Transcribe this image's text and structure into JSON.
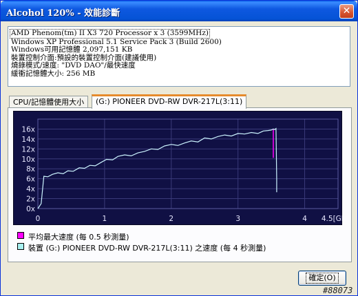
{
  "window": {
    "title": "Alcohol 120% - 效能診斷",
    "close_symbol": "✕"
  },
  "info": {
    "lines": [
      "AMD Phenom(tm) II X3 720 Processor x 3 (3599MHz)",
      "Windows XP Professional 5.1 Service Pack 3 (Build 2600)",
      "Windows可用記憶體 2,097,151 KB",
      "裝置控制介面:預設的裝置控制介面(建議使用)",
      "燒錄模式/速度: \"DVD DAO\"/最快速度",
      "緩衝記憶體大小: 256 MB"
    ]
  },
  "tabs": [
    {
      "label": "CPU/記憶體使用大小",
      "active": false
    },
    {
      "label": "(G:) PIONEER DVD-RW  DVR-217L(3:11)",
      "active": true
    }
  ],
  "chart_data": {
    "type": "line",
    "y_ticks": [
      "0x",
      "2x",
      "4x",
      "6x",
      "8x",
      "10x",
      "12x",
      "14x",
      "16x"
    ],
    "x_ticks": [
      "0",
      "1",
      "2",
      "3",
      "4",
      "4.5[GB]"
    ],
    "ylim": [
      0,
      18
    ],
    "xlim": [
      0,
      4.5
    ],
    "grid": true,
    "background": "#101044",
    "grid_color": "#3A3A7A",
    "series": [
      {
        "name": "平均最大速度 (每 0.5 秒測量)",
        "color": "#FF00FF",
        "x": [
          3.53,
          3.53
        ],
        "y": [
          16.0,
          10.2
        ]
      },
      {
        "name": "裝置 (G:) PIONEER DVD-RW  DVR-217L(3:11) 之速度 (每 4 秒測量)",
        "color": "#CCF4FF",
        "x": [
          0.0,
          0.05,
          0.09,
          0.15,
          0.22,
          0.3,
          0.38,
          0.45,
          0.53,
          0.62,
          0.7,
          0.78,
          0.86,
          0.95,
          1.03,
          1.12,
          1.2,
          1.3,
          1.4,
          1.5,
          1.6,
          1.7,
          1.8,
          1.9,
          2.0,
          2.1,
          2.2,
          2.3,
          2.4,
          2.5,
          2.6,
          2.7,
          2.8,
          2.9,
          3.0,
          3.1,
          3.2,
          3.3,
          3.38,
          3.45,
          3.5,
          3.53,
          3.55,
          3.57,
          3.58,
          3.58
        ],
        "y": [
          0.0,
          1.0,
          6.5,
          6.4,
          6.9,
          7.2,
          7.0,
          7.6,
          7.5,
          8.2,
          8.1,
          8.7,
          8.6,
          9.3,
          9.9,
          9.8,
          10.5,
          10.8,
          10.6,
          11.2,
          11.5,
          12.0,
          11.9,
          12.6,
          12.9,
          12.7,
          13.2,
          13.6,
          13.4,
          14.2,
          14.0,
          14.5,
          14.8,
          14.6,
          15.1,
          15.0,
          15.3,
          15.1,
          15.6,
          15.7,
          15.8,
          16.0,
          15.9,
          16.1,
          6.0,
          3.3
        ]
      }
    ]
  },
  "legend": [
    {
      "label": "平均最大速度 (每 0.5 秒測量)",
      "color": "#FF00FF"
    },
    {
      "label": "裝置 (G:) PIONEER DVD-RW  DVR-217L(3:11) 之速度 (每 4 秒測量)",
      "color": "#A8F0F0"
    }
  ],
  "footer": {
    "ok_label": "確定(O)",
    "watermark": "#88073"
  }
}
